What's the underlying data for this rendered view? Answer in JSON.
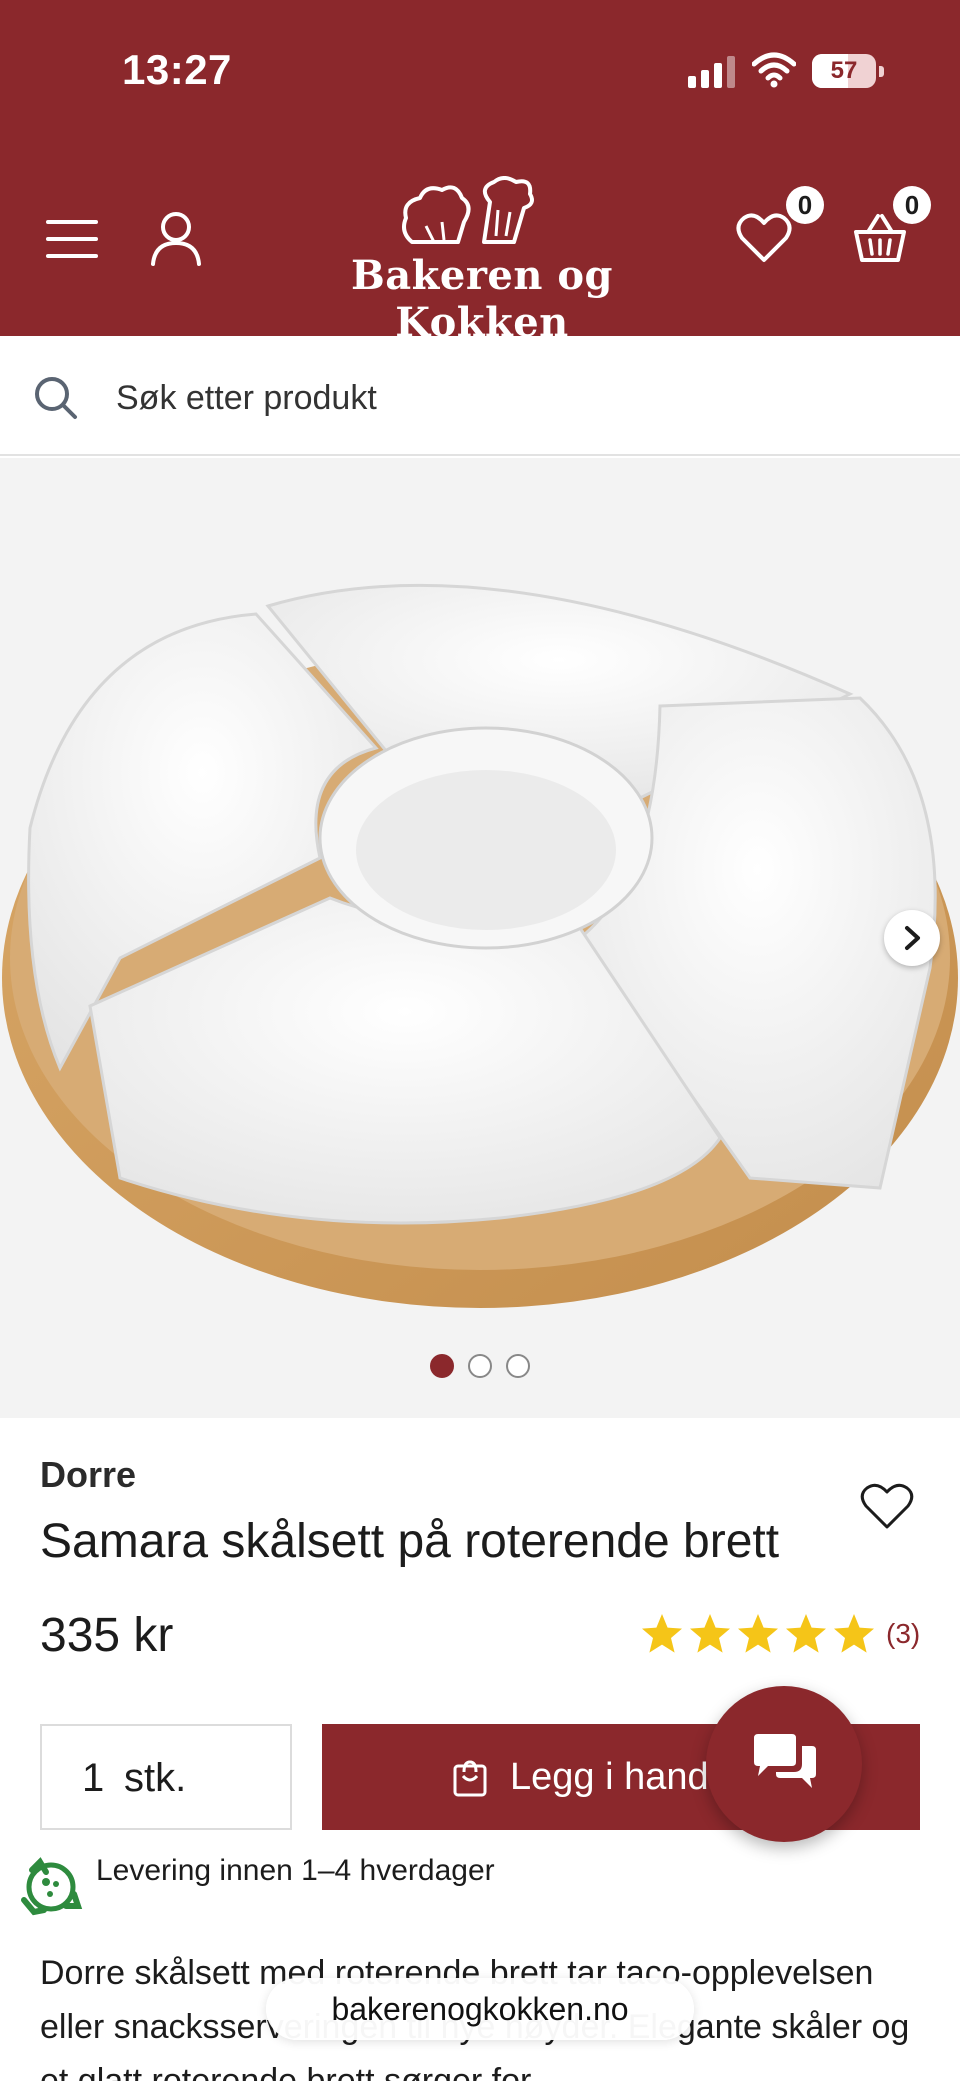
{
  "status_bar": {
    "time": "13:27",
    "battery": "57"
  },
  "header": {
    "logo_text": "Bakeren og Kokken",
    "wishlist_count": "0",
    "cart_count": "0",
    "brand_color": "#8b282c"
  },
  "search": {
    "placeholder": "Søk etter produkt"
  },
  "gallery": {
    "slide_count": 3,
    "active_slide": 1
  },
  "product": {
    "brand": "Dorre",
    "title": "Samara skålsett på roterende brett",
    "price": "335 kr",
    "rating": 5,
    "review_count": "(3)"
  },
  "purchase": {
    "quantity": "1",
    "unit": "stk.",
    "add_to_cart_label": "Legg i handlekurv"
  },
  "delivery_text": "Levering innen 1–4 hverdager",
  "description": "Dorre skålsett med roterende brett tar taco-opplevelsen eller snacksserveringen til nye høyder. Elegante skåler og et glatt roterende brett sørger for",
  "url_bar": {
    "domain": "bakerenogkokken.no"
  }
}
